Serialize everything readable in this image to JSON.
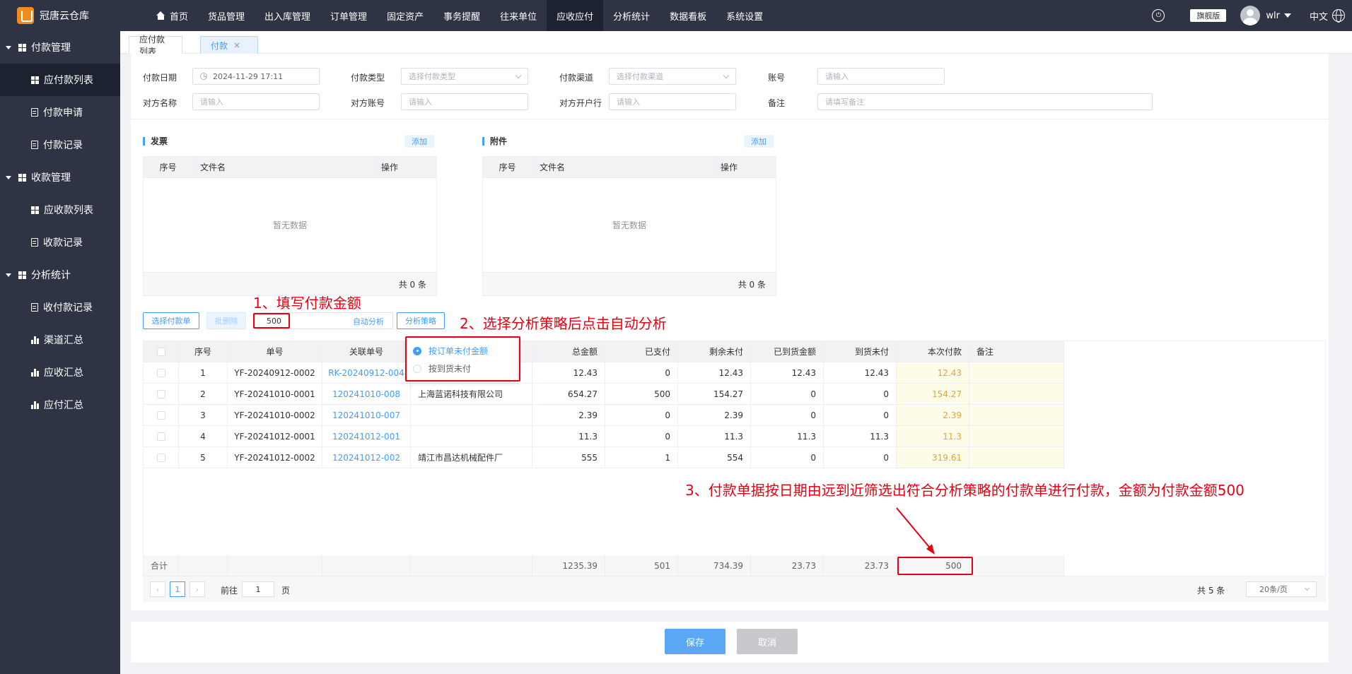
{
  "app": {
    "title": "冠唐云仓库"
  },
  "nav": {
    "items": [
      "首页",
      "货品管理",
      "出入库管理",
      "订单管理",
      "固定资产",
      "事务提醒",
      "往来单位",
      "应收应付",
      "分析统计",
      "数据看板",
      "系统设置"
    ],
    "active": "应收应付"
  },
  "topright": {
    "edition": "旗舰版",
    "user": "wlr",
    "lang": "中文"
  },
  "sidebar": {
    "groups": [
      {
        "label": "付款管理",
        "items": [
          "应付款列表",
          "付款申请",
          "付款记录"
        ]
      },
      {
        "label": "收款管理",
        "items": [
          "应收款列表",
          "收款记录"
        ]
      },
      {
        "label": "分析统计",
        "items": [
          "收付款记录",
          "渠道汇总",
          "应收汇总",
          "应付汇总"
        ]
      }
    ],
    "active": "应付款列表"
  },
  "tabs": [
    {
      "label": "应付款列表"
    },
    {
      "label": "付款",
      "closable": "×"
    }
  ],
  "form": {
    "pay_date_label": "付款日期",
    "pay_date_value": "2024-11-29 17:11",
    "pay_type_label": "付款类型",
    "pay_type_placeholder": "选择付款类型",
    "pay_channel_label": "付款渠道",
    "pay_channel_placeholder": "选择付款渠道",
    "account_label": "账号",
    "account_placeholder": "请输入",
    "counterparty_label": "对方名称",
    "counterparty_placeholder": "请输入",
    "cp_account_label": "对方账号",
    "cp_account_placeholder": "请输入",
    "cp_bank_label": "对方开户行",
    "cp_bank_placeholder": "请输入",
    "remark_label": "备注",
    "remark_placeholder": "请填写备注"
  },
  "invoice": {
    "title": "发票",
    "add": "添加",
    "cols": [
      "序号",
      "文件名",
      "操作"
    ],
    "empty": "暂无数据",
    "total": "共 0 条"
  },
  "attachment": {
    "title": "附件",
    "add": "添加",
    "cols": [
      "序号",
      "文件名",
      "操作"
    ],
    "empty": "暂无数据",
    "total": "共 0 条"
  },
  "toolbar": {
    "select_btn": "选择付款单",
    "batch_delete": "批删除",
    "amount": "500",
    "auto_analyze": "自动分析",
    "strategy_btn": "分析策略"
  },
  "strategy_options": [
    {
      "label": "按订单未付金额",
      "selected": true
    },
    {
      "label": "按到货未付",
      "selected": false
    }
  ],
  "table": {
    "columns": [
      "",
      "序号",
      "单号",
      "关联单号",
      "",
      "总金额",
      "已支付",
      "剩余未付",
      "已到货金额",
      "到货未付",
      "本次付款",
      "备注"
    ],
    "rows": [
      {
        "no": "1",
        "order": "YF-20240912-0002",
        "related": "RK-20240912-004",
        "company": "",
        "total": "12.43",
        "paid": "0",
        "remaining": "12.43",
        "arrived": "12.43",
        "arrived_unpaid": "12.43",
        "this_pay": "12.43",
        "remark": ""
      },
      {
        "no": "2",
        "order": "YF-20241010-0001",
        "related": "120241010-008",
        "company": "上海蓝诺科技有限公司",
        "total": "654.27",
        "paid": "500",
        "remaining": "154.27",
        "arrived": "0",
        "arrived_unpaid": "0",
        "this_pay": "154.27",
        "remark": ""
      },
      {
        "no": "3",
        "order": "YF-20241010-0002",
        "related": "120241010-007",
        "company": "",
        "total": "2.39",
        "paid": "0",
        "remaining": "2.39",
        "arrived": "0",
        "arrived_unpaid": "0",
        "this_pay": "2.39",
        "remark": ""
      },
      {
        "no": "4",
        "order": "YF-20241012-0001",
        "related": "120241012-001",
        "company": "",
        "total": "11.3",
        "paid": "0",
        "remaining": "11.3",
        "arrived": "11.3",
        "arrived_unpaid": "11.3",
        "this_pay": "11.3",
        "remark": ""
      },
      {
        "no": "5",
        "order": "YF-20241012-0002",
        "related": "120241012-002",
        "company": "靖江市昌达机械配件厂",
        "total": "555",
        "paid": "1",
        "remaining": "554",
        "arrived": "0",
        "arrived_unpaid": "0",
        "this_pay": "319.61",
        "remark": ""
      }
    ],
    "footer": {
      "label": "合计",
      "total": "1235.39",
      "paid": "501",
      "remaining": "734.39",
      "arrived": "23.73",
      "arrived_unpaid": "23.73",
      "this_pay": "500"
    }
  },
  "pagination": {
    "prev": "‹",
    "page": "1",
    "next": "›",
    "goto_prefix": "前往",
    "goto_value": "1",
    "goto_suffix": "页",
    "total": "共 5 条",
    "page_size": "20条/页"
  },
  "actions": {
    "save": "保存",
    "cancel": "取消"
  },
  "annotations": [
    "1、填写付款金额",
    "2、选择分析策略后点击自动分析",
    "3、付款单据按日期由远到近筛选出符合分析策略的付款单进行付款，金额为付款金额500"
  ],
  "colors": {
    "primary": "#409eff",
    "annotation": "#e60012",
    "sidebar": "#2e3444",
    "pay_column": "#fdfde7"
  }
}
